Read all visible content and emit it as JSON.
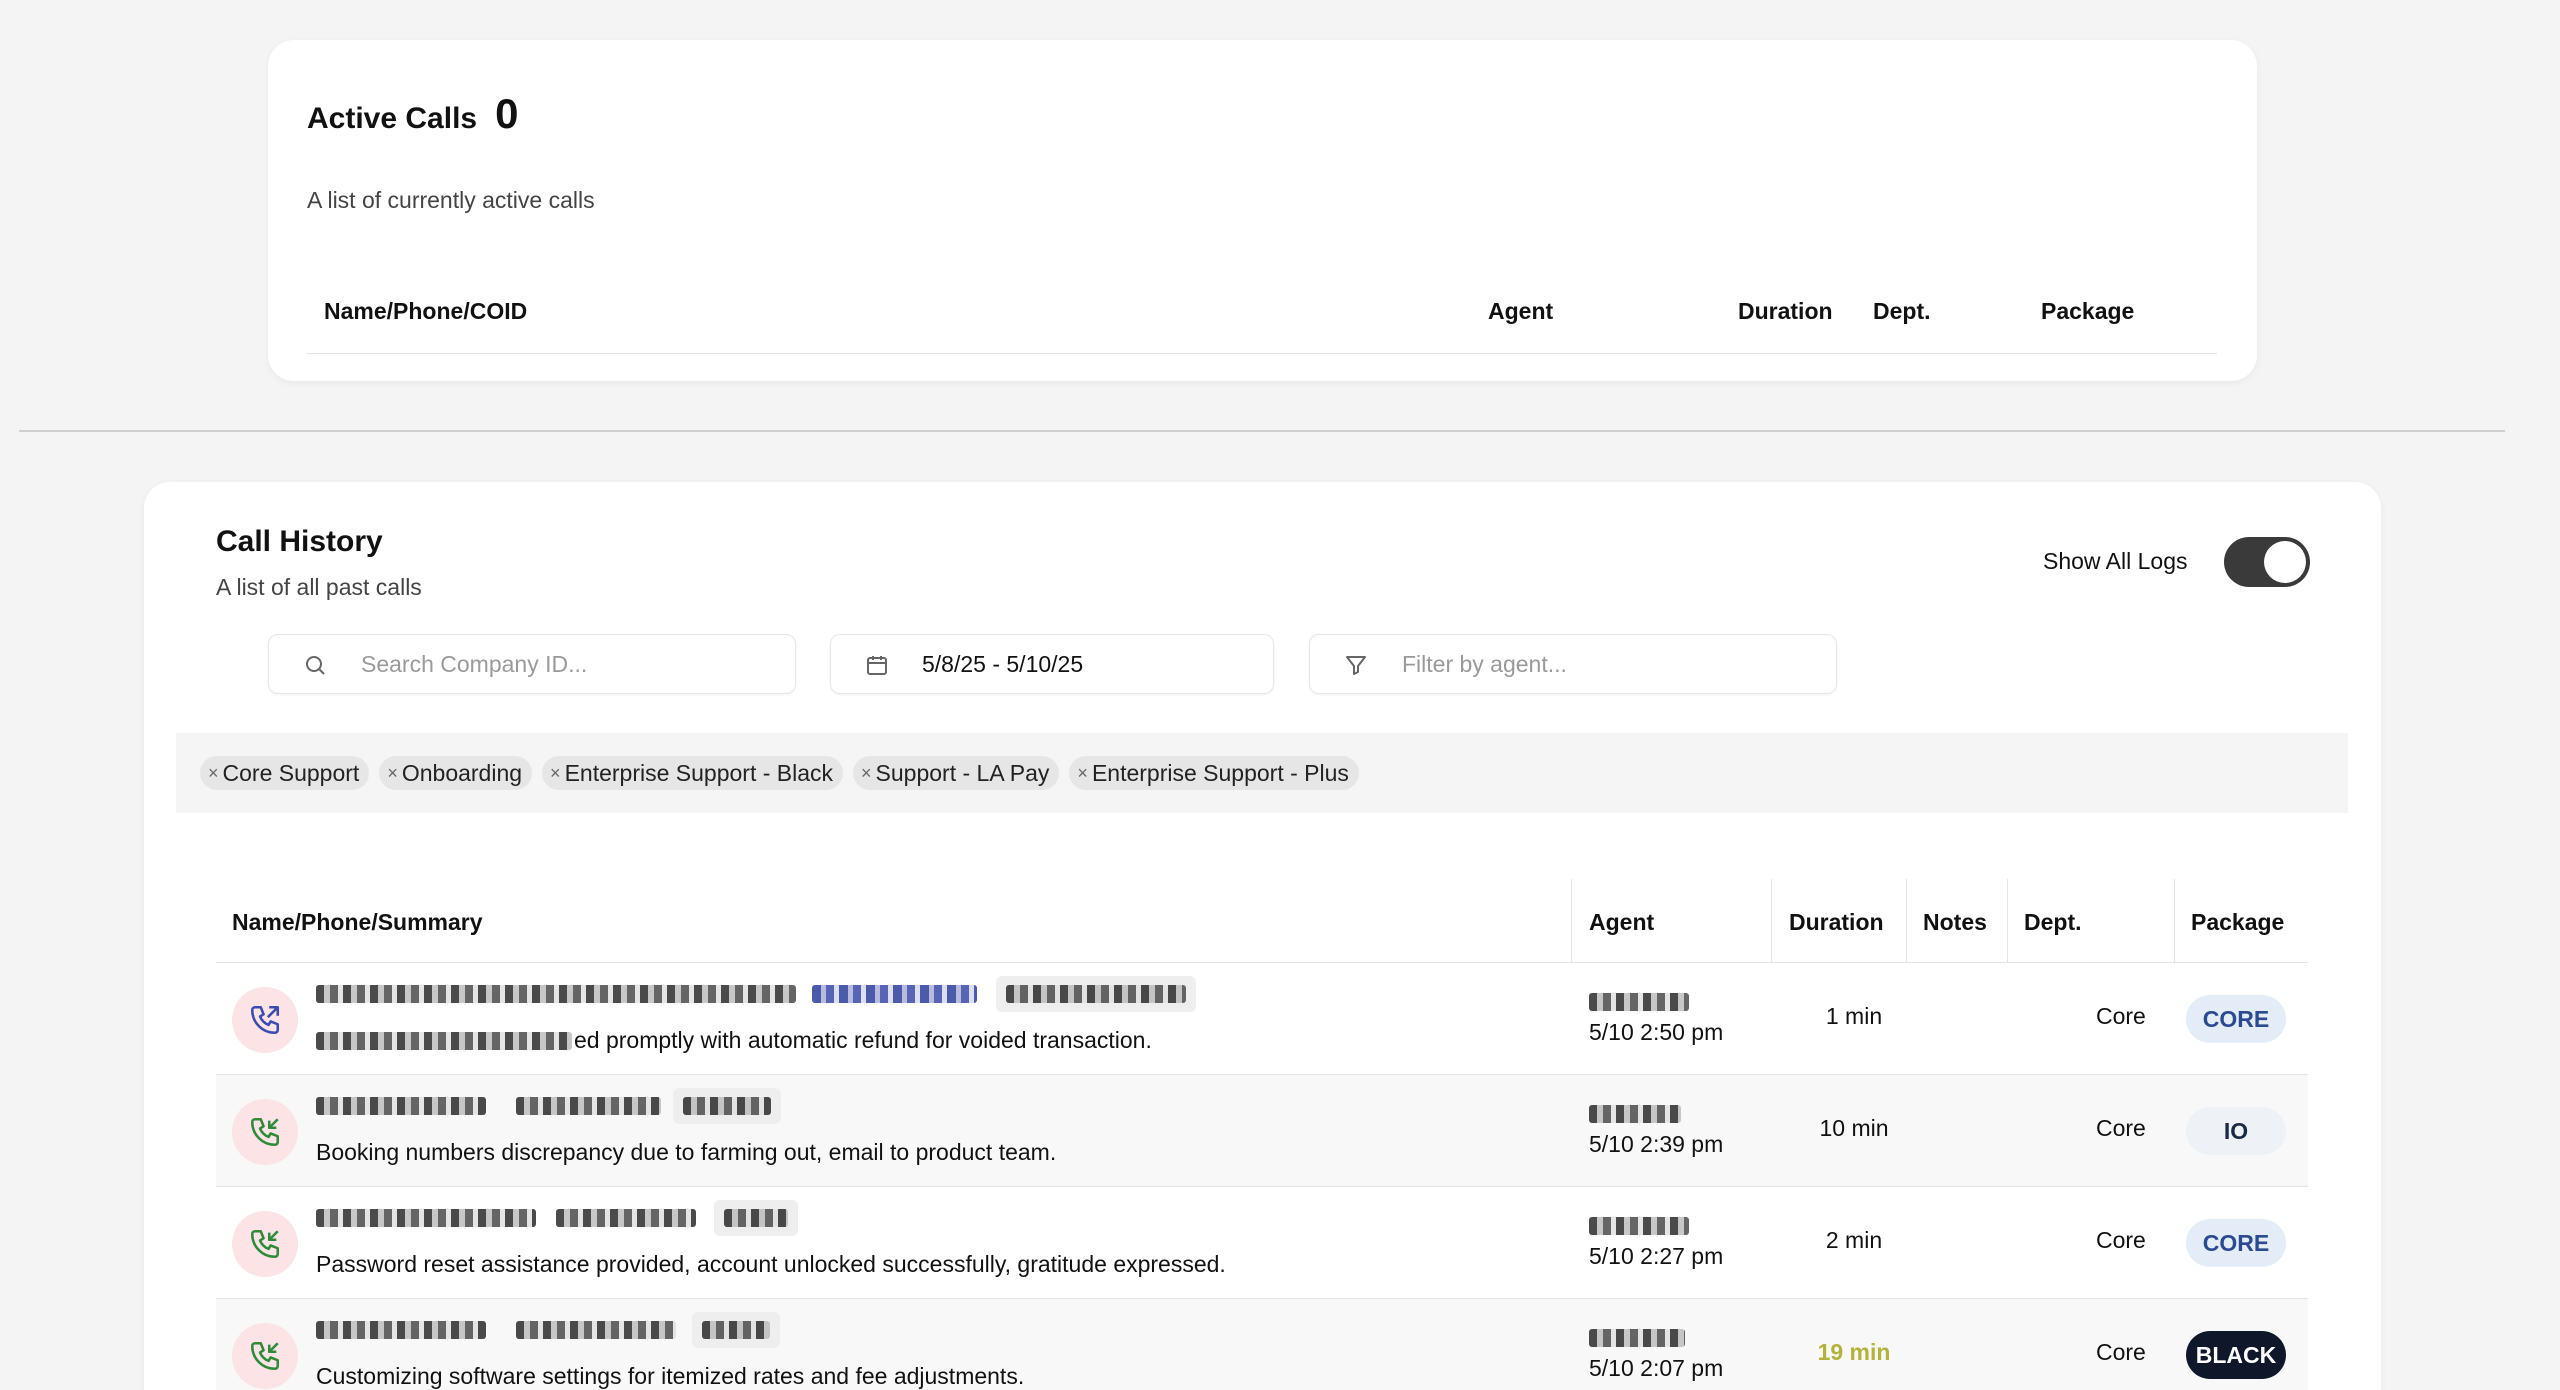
{
  "active_calls": {
    "title": "Active Calls",
    "count": "0",
    "subtitle": "A list of currently active calls",
    "columns": [
      "Name/Phone/COID",
      "Agent",
      "Duration",
      "Dept.",
      "Package"
    ]
  },
  "call_history": {
    "title": "Call History",
    "subtitle": "A list of all past calls",
    "show_all_label": "Show All Logs",
    "show_all_on": true,
    "search": {
      "placeholder": "Search Company ID..."
    },
    "date_range": "5/8/25 - 5/10/25",
    "agent_filter": {
      "placeholder": "Filter by agent..."
    },
    "dept_tags": [
      "Core Support",
      "Onboarding",
      "Enterprise Support - Black",
      "Support - LA Pay",
      "Enterprise Support - Plus"
    ],
    "tag_remove_glyph": "×",
    "columns": [
      "Name/Phone/Summary",
      "Agent",
      "Duration",
      "Notes",
      "Dept.",
      "Package"
    ],
    "rows": [
      {
        "summary": "ed promptly with automatic refund for voided transaction.",
        "time": "5/10 2:50 pm",
        "duration": "1 min",
        "dept": "Core",
        "package": "CORE",
        "direction": "outbound"
      },
      {
        "summary": "Booking numbers discrepancy due to farming out, email to product team.",
        "time": "5/10 2:39 pm",
        "duration": "10 min",
        "dept": "Core",
        "package": "IO",
        "direction": "inbound"
      },
      {
        "summary": "Password reset assistance provided, account unlocked successfully, gratitude expressed.",
        "time": "5/10 2:27 pm",
        "duration": "2 min",
        "dept": "Core",
        "package": "CORE",
        "direction": "inbound"
      },
      {
        "summary": "Customizing software settings for itemized rates and fee adjustments.",
        "time": "5/10 2:07 pm",
        "duration": "19 min",
        "dept": "Core",
        "package": "BLACK",
        "direction": "inbound"
      }
    ]
  },
  "colors": {
    "core_badge_bg": "#e4ecf8",
    "core_badge_text": "#2b4a8f",
    "io_badge_bg": "#eef1f6",
    "io_badge_text": "#1a2a44",
    "black_badge_bg": "#0f172a",
    "black_badge_text": "#ffffff",
    "long_duration": "#b3b33a",
    "call_icon_bg": "#fbe3e6",
    "outbound_icon": "#3b4bb0",
    "inbound_icon": "#2f8a3a"
  }
}
